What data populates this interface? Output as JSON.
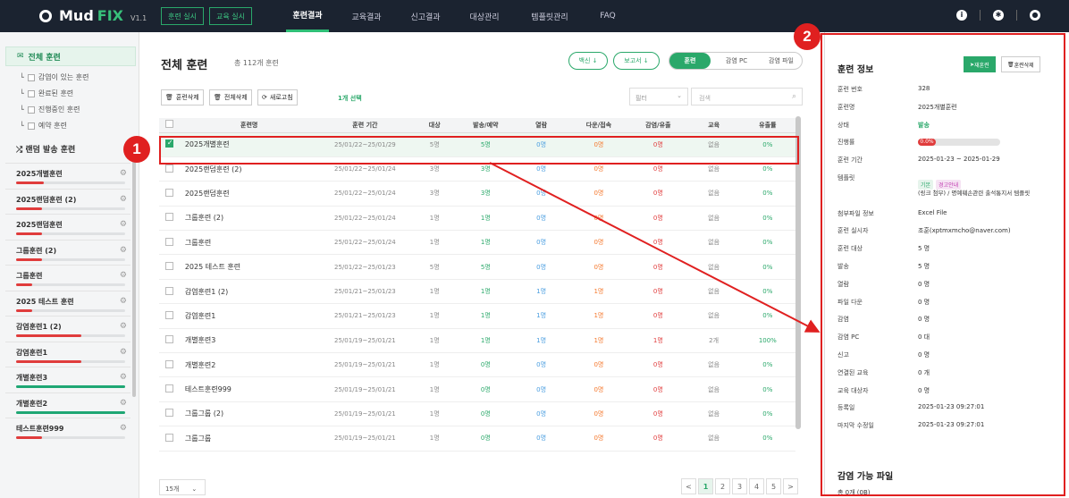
{
  "app": {
    "logo_main": "Mud",
    "logo_accent": "FIX",
    "version": "V1.1"
  },
  "top_buttons": [
    "훈련 실시",
    "교육 실시"
  ],
  "nav": [
    {
      "label": "훈련결과",
      "active": true
    },
    {
      "label": "교육결과",
      "active": false
    },
    {
      "label": "신고결과",
      "active": false
    },
    {
      "label": "대상관리",
      "active": false
    },
    {
      "label": "템플릿관리",
      "active": false
    },
    {
      "label": "FAQ",
      "active": false
    }
  ],
  "sidebar": {
    "all": "전체 훈련",
    "subs": [
      "감염이 있는 훈련",
      "완료된 훈련",
      "진행중인 훈련",
      "예약 훈련"
    ],
    "random": "랜덤 발송 훈련",
    "items": [
      {
        "label": "2025개별훈련",
        "progress": 0.25,
        "color": "#e03c3c"
      },
      {
        "label": "2025랜덤훈련 (2)",
        "progress": 0.0,
        "color": "#e03c3c"
      },
      {
        "label": "2025랜덤훈련",
        "progress": 0.0,
        "color": "#e03c3c"
      },
      {
        "label": "그룹훈련 (2)",
        "progress": 0.0,
        "color": "#e03c3c"
      },
      {
        "label": "그룹훈련",
        "progress": 0.15,
        "color": "#e03c3c"
      },
      {
        "label": "2025 테스트 훈련",
        "progress": 0.15,
        "color": "#e03c3c"
      },
      {
        "label": "감염훈련1 (2)",
        "progress": 0.6,
        "color": "#e03c3c"
      },
      {
        "label": "감염훈련1",
        "progress": 0.6,
        "color": "#e03c3c"
      },
      {
        "label": "개별훈련3",
        "progress": 1.0,
        "color": "#1fa774"
      },
      {
        "label": "개별훈련2",
        "progress": 1.0,
        "color": "#1fa774"
      },
      {
        "label": "테스트훈련999",
        "progress": 0.0,
        "color": "#e03c3c"
      }
    ]
  },
  "main": {
    "title": "전체 훈련",
    "count": "총 112개 훈련",
    "btn_backup": "백신 ↓",
    "btn_report": "보고서 ↓",
    "seg": [
      "훈련",
      "감염 PC",
      "감염 파일"
    ],
    "btn_delete": "훈련삭제",
    "btn_delete_all": "전체삭제",
    "btn_refresh": "새로고침",
    "selected": "1개 선택",
    "filter": "필터",
    "search_placeholder": "검색",
    "columns": [
      "훈련명",
      "훈련 기간",
      "대상",
      "발송/예약",
      "열람",
      "다운/접속",
      "감염/유출",
      "교육",
      "유출률"
    ],
    "rows": [
      [
        "2025개별훈련",
        "25/01/22~25/01/29",
        "5명",
        "5명",
        "0명",
        "0명",
        "0명",
        "없음",
        "0%"
      ],
      [
        "2025랜덤훈련 (2)",
        "25/01/22~25/01/24",
        "3명",
        "3명",
        "0명",
        "0명",
        "0명",
        "없음",
        "0%"
      ],
      [
        "2025랜덤훈련",
        "25/01/22~25/01/24",
        "3명",
        "3명",
        "0명",
        "0명",
        "0명",
        "없음",
        "0%"
      ],
      [
        "그룹훈련 (2)",
        "25/01/22~25/01/24",
        "1명",
        "1명",
        "0명",
        "0명",
        "0명",
        "없음",
        "0%"
      ],
      [
        "그룹훈련",
        "25/01/22~25/01/24",
        "1명",
        "1명",
        "0명",
        "0명",
        "0명",
        "없음",
        "0%"
      ],
      [
        "2025 테스트 훈련",
        "25/01/22~25/01/23",
        "5명",
        "5명",
        "0명",
        "0명",
        "0명",
        "없음",
        "0%"
      ],
      [
        "감염훈련1 (2)",
        "25/01/21~25/01/23",
        "1명",
        "1명",
        "1명",
        "1명",
        "0명",
        "없음",
        "0%"
      ],
      [
        "감염훈련1",
        "25/01/21~25/01/23",
        "1명",
        "1명",
        "1명",
        "1명",
        "0명",
        "없음",
        "0%"
      ],
      [
        "개별훈련3",
        "25/01/19~25/01/21",
        "1명",
        "1명",
        "1명",
        "1명",
        "1명",
        "2개",
        "100%"
      ],
      [
        "개별훈련2",
        "25/01/19~25/01/21",
        "1명",
        "0명",
        "0명",
        "0명",
        "0명",
        "없음",
        "0%"
      ],
      [
        "테스트훈련999",
        "25/01/19~25/01/21",
        "1명",
        "0명",
        "0명",
        "0명",
        "0명",
        "없음",
        "0%"
      ],
      [
        "그룹그룹 (2)",
        "25/01/19~25/01/21",
        "1명",
        "0명",
        "0명",
        "0명",
        "0명",
        "없음",
        "0%"
      ],
      [
        "그룹그룹",
        "25/01/19~25/01/21",
        "1명",
        "0명",
        "0명",
        "0명",
        "0명",
        "없음",
        "0%"
      ]
    ],
    "page_size": "15개",
    "pages": [
      "<",
      "1",
      "2",
      "3",
      "4",
      "5",
      ">"
    ]
  },
  "panel": {
    "title": "훈련 정보",
    "btn_resend": "재훈련",
    "btn_delete": "훈련삭제",
    "fields": [
      [
        "훈련 번호",
        "328"
      ],
      [
        "훈련명",
        "2025개별훈련"
      ],
      [
        "상태",
        "발송"
      ],
      [
        "진행률",
        ""
      ],
      [
        "훈련 기간",
        "2025-01-23 ~ 2025-01-29"
      ],
      [
        "템플릿",
        ""
      ],
      [
        "",
        ""
      ],
      [
        "첨부파일 정보",
        "Excel File"
      ],
      [
        "훈련 실시자",
        "조훈(xptmxmcho@naver.com)"
      ],
      [
        "훈련 대상",
        "5 명"
      ],
      [
        "발송",
        "5 명"
      ],
      [
        "열람",
        "0 명"
      ],
      [
        "파일 다운",
        "0 명"
      ],
      [
        "감염",
        "0 명"
      ],
      [
        "감염 PC",
        "0 대"
      ],
      [
        "신고",
        "0 명"
      ],
      [
        "연결된 교육",
        "0 개"
      ],
      [
        "교육 대상자",
        "0 명"
      ],
      [
        "등록일",
        "2025-01-23 09:27:01"
      ],
      [
        "마지막 수정일",
        "2025-01-23 09:27:01"
      ]
    ],
    "progress_label": "0.0%",
    "progress": 0.0,
    "tag1": "기본",
    "tag2": "경고안내",
    "template_desc": "(링크 첨부) / 명예훼손관련 출석통지서 템플릿",
    "sub_title": "감염 가능 파일",
    "sub_text": "총 0개 (0B)"
  },
  "annotations": {
    "badge1": "1",
    "badge2": "2"
  }
}
